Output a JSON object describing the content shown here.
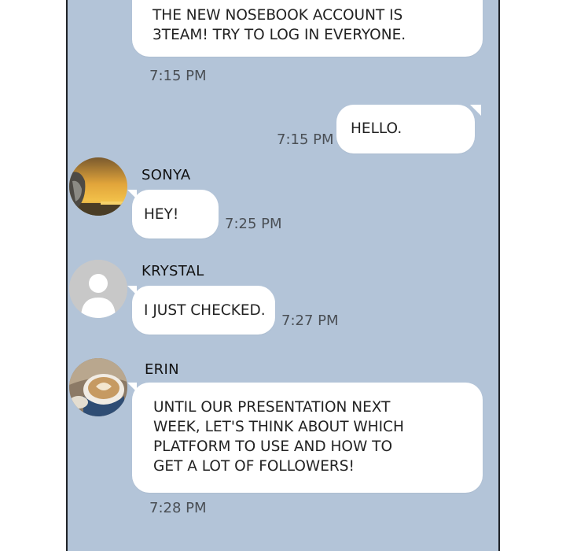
{
  "messages": {
    "m1": {
      "text": "THE NEW NOSEBOOK ACCOUNT IS\n3TEAM! TRY TO LOG IN EVERYONE.",
      "time": "7:15 PM"
    },
    "m2": {
      "text": "HELLO.",
      "time": "7:15 PM"
    },
    "m3": {
      "sender": "SONYA",
      "text": "HEY!",
      "time": "7:25 PM"
    },
    "m4": {
      "sender": "KRYSTAL",
      "text": "I JUST CHECKED.",
      "time": "7:27 PM"
    },
    "m5": {
      "sender": "ERIN",
      "text": "UNTIL OUR PRESENTATION NEXT\nWEEK, LET'S THINK ABOUT WHICH\nPLATFORM TO USE AND HOW TO\nGET A LOT OF FOLLOWERS!",
      "time": "7:28 PM"
    }
  },
  "colors": {
    "chat_background": "#b3c4d8",
    "bubble": "#ffffff",
    "timestamp": "#4a4f55"
  },
  "icons": {
    "sonya_avatar": "sunset-illustration-avatar",
    "krystal_avatar": "default-user-silhouette-icon",
    "erin_avatar": "coffee-cup-avatar"
  }
}
